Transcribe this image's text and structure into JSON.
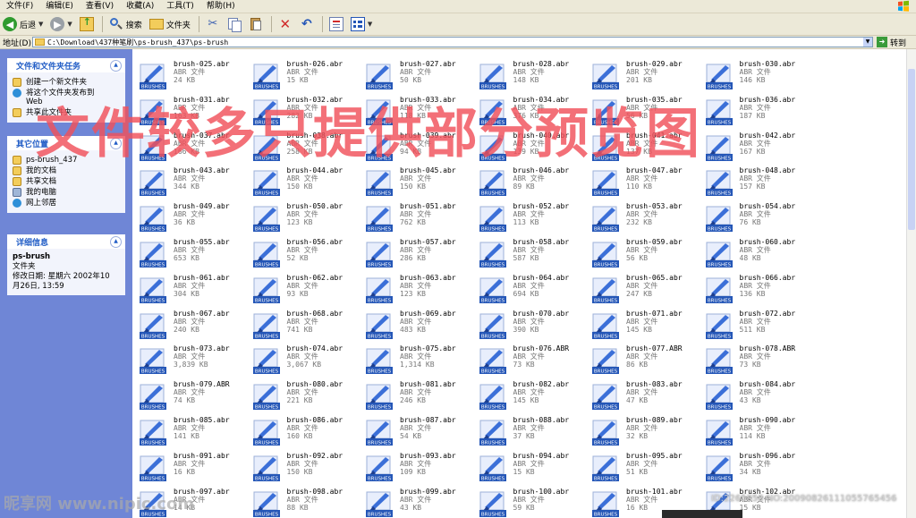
{
  "menu": [
    "文件(F)",
    "编辑(E)",
    "查看(V)",
    "收藏(A)",
    "工具(T)",
    "帮助(H)"
  ],
  "toolbar": {
    "back_label": "后退",
    "search_label": "搜索",
    "folders_label": "文件夹"
  },
  "address": {
    "label": "地址(D)",
    "value": "C:\\Download\\437种笔刷\\ps-brush_437\\ps-brush",
    "go_label": "转到"
  },
  "tasks": {
    "title": "文件和文件夹任务",
    "links": [
      "创建一个新文件夹",
      "将这个文件夹发布到",
      "Web",
      "共享此文件夹"
    ]
  },
  "other_places": {
    "title": "其它位置",
    "links": [
      "ps-brush_437",
      "我的文档",
      "共享文档",
      "我的电脑",
      "网上邻居"
    ]
  },
  "details": {
    "title": "详细信息",
    "name": "ps-brush",
    "type": "文件夹",
    "modified_line1": "修改日期: 星期六 2002年10",
    "modified_line2": "月26日, 13:59"
  },
  "files": [
    {
      "name": "brush-025.abr",
      "type": "ABR 文件",
      "size": "24 KB"
    },
    {
      "name": "brush-026.abr",
      "type": "ABR 文件",
      "size": "15 KB"
    },
    {
      "name": "brush-027.abr",
      "type": "ABR 文件",
      "size": "50 KB"
    },
    {
      "name": "brush-028.abr",
      "type": "ABR 文件",
      "size": "148 KB"
    },
    {
      "name": "brush-029.abr",
      "type": "ABR 文件",
      "size": "201 KB"
    },
    {
      "name": "brush-030.abr",
      "type": "ABR 文件",
      "size": "146 KB"
    },
    {
      "name": "brush-031.abr",
      "type": "ABR 文件",
      "size": "163 KB"
    },
    {
      "name": "brush-032.abr",
      "type": "ABR 文件",
      "size": "282 KB"
    },
    {
      "name": "brush-033.abr",
      "type": "ABR 文件",
      "size": "118 KB"
    },
    {
      "name": "brush-034.abr",
      "type": "ABR 文件",
      "size": "376 KB"
    },
    {
      "name": "brush-035.abr",
      "type": "ABR 文件",
      "size": "56 KB"
    },
    {
      "name": "brush-036.abr",
      "type": "ABR 文件",
      "size": "187 KB"
    },
    {
      "name": "brush-037.abr",
      "type": "ABR 文件",
      "size": "166 KB"
    },
    {
      "name": "brush-038.abr",
      "type": "ABR 文件",
      "size": "258 KB"
    },
    {
      "name": "brush-039.abr",
      "type": "ABR 文件",
      "size": "94 KB"
    },
    {
      "name": "brush-040.abr",
      "type": "ABR 文件",
      "size": "139 KB"
    },
    {
      "name": "brush-041.abr",
      "type": "ABR 文件",
      "size": "137 KB"
    },
    {
      "name": "brush-042.abr",
      "type": "ABR 文件",
      "size": "167 KB"
    },
    {
      "name": "brush-043.abr",
      "type": "ABR 文件",
      "size": "344 KB"
    },
    {
      "name": "brush-044.abr",
      "type": "ABR 文件",
      "size": "150 KB"
    },
    {
      "name": "brush-045.abr",
      "type": "ABR 文件",
      "size": "150 KB"
    },
    {
      "name": "brush-046.abr",
      "type": "ABR 文件",
      "size": "89 KB"
    },
    {
      "name": "brush-047.abr",
      "type": "ABR 文件",
      "size": "110 KB"
    },
    {
      "name": "brush-048.abr",
      "type": "ABR 文件",
      "size": "157 KB"
    },
    {
      "name": "brush-049.abr",
      "type": "ABR 文件",
      "size": "36 KB"
    },
    {
      "name": "brush-050.abr",
      "type": "ABR 文件",
      "size": "123 KB"
    },
    {
      "name": "brush-051.abr",
      "type": "ABR 文件",
      "size": "762 KB"
    },
    {
      "name": "brush-052.abr",
      "type": "ABR 文件",
      "size": "113 KB"
    },
    {
      "name": "brush-053.abr",
      "type": "ABR 文件",
      "size": "232 KB"
    },
    {
      "name": "brush-054.abr",
      "type": "ABR 文件",
      "size": "76 KB"
    },
    {
      "name": "brush-055.abr",
      "type": "ABR 文件",
      "size": "653 KB"
    },
    {
      "name": "brush-056.abr",
      "type": "ABR 文件",
      "size": "52 KB"
    },
    {
      "name": "brush-057.abr",
      "type": "ABR 文件",
      "size": "286 KB"
    },
    {
      "name": "brush-058.abr",
      "type": "ABR 文件",
      "size": "587 KB"
    },
    {
      "name": "brush-059.abr",
      "type": "ABR 文件",
      "size": "56 KB"
    },
    {
      "name": "brush-060.abr",
      "type": "ABR 文件",
      "size": "48 KB"
    },
    {
      "name": "brush-061.abr",
      "type": "ABR 文件",
      "size": "304 KB"
    },
    {
      "name": "brush-062.abr",
      "type": "ABR 文件",
      "size": "93 KB"
    },
    {
      "name": "brush-063.abr",
      "type": "ABR 文件",
      "size": "123 KB"
    },
    {
      "name": "brush-064.abr",
      "type": "ABR 文件",
      "size": "694 KB"
    },
    {
      "name": "brush-065.abr",
      "type": "ABR 文件",
      "size": "247 KB"
    },
    {
      "name": "brush-066.abr",
      "type": "ABR 文件",
      "size": "136 KB"
    },
    {
      "name": "brush-067.abr",
      "type": "ABR 文件",
      "size": "240 KB"
    },
    {
      "name": "brush-068.abr",
      "type": "ABR 文件",
      "size": "741 KB"
    },
    {
      "name": "brush-069.abr",
      "type": "ABR 文件",
      "size": "483 KB"
    },
    {
      "name": "brush-070.abr",
      "type": "ABR 文件",
      "size": "390 KB"
    },
    {
      "name": "brush-071.abr",
      "type": "ABR 文件",
      "size": "145 KB"
    },
    {
      "name": "brush-072.abr",
      "type": "ABR 文件",
      "size": "511 KB"
    },
    {
      "name": "brush-073.abr",
      "type": "ABR 文件",
      "size": "3,839 KB"
    },
    {
      "name": "brush-074.abr",
      "type": "ABR 文件",
      "size": "3,067 KB"
    },
    {
      "name": "brush-075.abr",
      "type": "ABR 文件",
      "size": "1,314 KB"
    },
    {
      "name": "brush-076.ABR",
      "type": "ABR 文件",
      "size": "73 KB"
    },
    {
      "name": "brush-077.ABR",
      "type": "ABR 文件",
      "size": "86 KB"
    },
    {
      "name": "brush-078.ABR",
      "type": "ABR 文件",
      "size": "73 KB"
    },
    {
      "name": "brush-079.ABR",
      "type": "ABR 文件",
      "size": "74 KB"
    },
    {
      "name": "brush-080.abr",
      "type": "ABR 文件",
      "size": "221 KB"
    },
    {
      "name": "brush-081.abr",
      "type": "ABR 文件",
      "size": "246 KB"
    },
    {
      "name": "brush-082.abr",
      "type": "ABR 文件",
      "size": "145 KB"
    },
    {
      "name": "brush-083.abr",
      "type": "ABR 文件",
      "size": "47 KB"
    },
    {
      "name": "brush-084.abr",
      "type": "ABR 文件",
      "size": "43 KB"
    },
    {
      "name": "brush-085.abr",
      "type": "ABR 文件",
      "size": "141 KB"
    },
    {
      "name": "brush-086.abr",
      "type": "ABR 文件",
      "size": "160 KB"
    },
    {
      "name": "brush-087.abr",
      "type": "ABR 文件",
      "size": "54 KB"
    },
    {
      "name": "brush-088.abr",
      "type": "ABR 文件",
      "size": "37 KB"
    },
    {
      "name": "brush-089.abr",
      "type": "ABR 文件",
      "size": "32 KB"
    },
    {
      "name": "brush-090.abr",
      "type": "ABR 文件",
      "size": "114 KB"
    },
    {
      "name": "brush-091.abr",
      "type": "ABR 文件",
      "size": "16 KB"
    },
    {
      "name": "brush-092.abr",
      "type": "ABR 文件",
      "size": "150 KB"
    },
    {
      "name": "brush-093.abr",
      "type": "ABR 文件",
      "size": "109 KB"
    },
    {
      "name": "brush-094.abr",
      "type": "ABR 文件",
      "size": "15 KB"
    },
    {
      "name": "brush-095.abr",
      "type": "ABR 文件",
      "size": "51 KB"
    },
    {
      "name": "brush-096.abr",
      "type": "ABR 文件",
      "size": "34 KB"
    },
    {
      "name": "brush-097.abr",
      "type": "ABR 文件",
      "size": "14 KB"
    },
    {
      "name": "brush-098.abr",
      "type": "ABR 文件",
      "size": "88 KB"
    },
    {
      "name": "brush-099.abr",
      "type": "ABR 文件",
      "size": "43 KB"
    },
    {
      "name": "brush-100.abr",
      "type": "ABR 文件",
      "size": "59 KB"
    },
    {
      "name": "brush-101.abr",
      "type": "ABR 文件",
      "size": "16 KB"
    },
    {
      "name": "brush-102.abr",
      "type": "ABR 文件",
      "size": "15 KB"
    }
  ],
  "icon_label": "BRUSHES",
  "overlay": {
    "banner": "文件较多只提供部分预览图",
    "watermark_logo": "昵享网 www.nipic.com",
    "watermark_id": "ID:2265858 NO:20090826111055765456"
  },
  "colors": {
    "taskpane_bg": "#6f86d6",
    "panel_header_text": "#215dc6",
    "banner": "#f0505a"
  }
}
